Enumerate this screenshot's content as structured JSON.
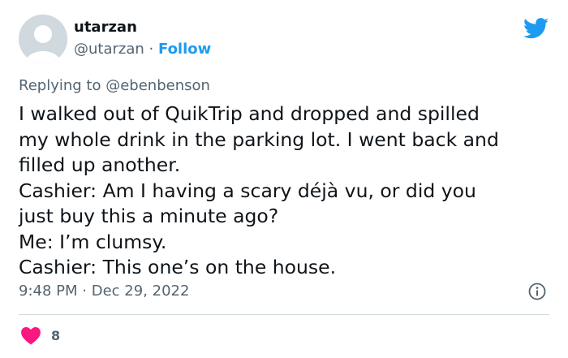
{
  "tweet": {
    "user": {
      "display_name": "utarzan",
      "handle": "@utarzan",
      "separator": "·",
      "follow_label": "Follow"
    },
    "replying_to": {
      "prefix": "Replying to",
      "mention": "@ebenbenson"
    },
    "body_lines": [
      "I walked out of QuikTrip and dropped and spilled",
      "my whole drink in the parking lot. I went back and",
      "filled up another.",
      "Cashier: Am I having a scary déjà vu, or did you",
      "just buy this a minute ago?",
      "Me: I’m clumsy.",
      "Cashier: This one’s on the house."
    ],
    "time": "9:48 PM",
    "meta_separator": "·",
    "date": "Dec 29, 2022",
    "likes": "8"
  },
  "icons": {
    "brand": "twitter-bird-icon",
    "info": "info-icon",
    "like": "heart-icon"
  },
  "colors": {
    "accent": "#1d9bf0",
    "like": "#f91880",
    "text": "#0f1419",
    "secondary": "#536471"
  }
}
